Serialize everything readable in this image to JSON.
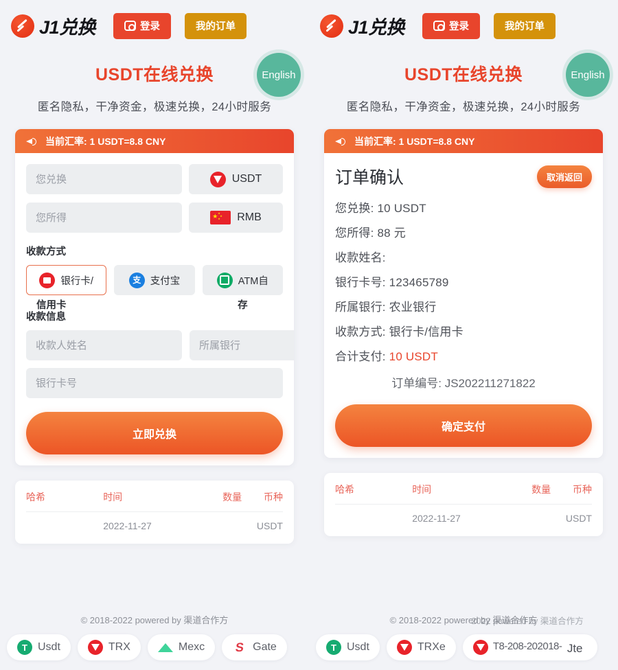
{
  "header": {
    "brand_name": "J1兑换",
    "login_label": "登录",
    "orders_label": "我的订单",
    "wallet_icon": "wallet-icon"
  },
  "hero": {
    "title": "USDT在线兑换",
    "subtitle": "匿名隐私，干净资金，极速兑换，24小时服务",
    "lang_badge": "English"
  },
  "rate_bar": {
    "text": "当前汇率: 1 USDT=8.8 CNY",
    "icon": "megaphone-icon"
  },
  "exchange_form": {
    "pay_placeholder": "您兑换",
    "receive_placeholder": "您所得",
    "pay_currency": "USDT",
    "receive_currency": "RMB",
    "pay_currency_icon": "tron-usdt-icon",
    "receive_currency_icon": "china-flag-icon",
    "method_label": "收款方式",
    "methods": [
      {
        "label": "银行卡/",
        "overflow": "信用卡",
        "icon": "bank-card-icon",
        "active": true
      },
      {
        "label": "支付宝",
        "overflow": "",
        "icon": "alipay-icon",
        "active": false
      },
      {
        "label": "ATM自",
        "overflow": "存",
        "icon": "atm-icon",
        "active": false
      }
    ],
    "info_label": "收款信息",
    "name_placeholder": "收款人姓名",
    "bank_placeholder": "所属银行",
    "card_placeholder": "银行卡号",
    "submit_label": "立即兑换"
  },
  "order_confirm": {
    "title": "订单确认",
    "cancel_label": "取消返回",
    "lines": [
      {
        "label": "您兑换:",
        "value": "10 USDT",
        "accent": false
      },
      {
        "label": "您所得:",
        "value": "88 元",
        "accent": false
      },
      {
        "label": "收款姓名:",
        "value": "",
        "accent": false
      },
      {
        "label": "银行卡号:",
        "value": "123465789",
        "accent": false
      },
      {
        "label": "所属银行:",
        "value": "农业银行",
        "accent": false
      },
      {
        "label": "收款方式:",
        "value": "银行卡/信用卡",
        "accent": false
      },
      {
        "label": "合计支付:",
        "value": "10 USDT",
        "accent": true
      }
    ],
    "order_no_label": "订单编号:",
    "order_no": "JS202211271822",
    "submit_label": "确定支付"
  },
  "tx_table": {
    "headers": [
      "哈希",
      "时间",
      "数量",
      "币种"
    ],
    "rows": [
      {
        "hash": "",
        "time": "2022-11-27",
        "amount": "",
        "coin": "USDT"
      }
    ]
  },
  "footer": {
    "copyright": "© 2018-2022 powered by 渠道合作方",
    "copyright_glitch_ghost": "2022 powered by 渠道合作方",
    "chips_left": [
      {
        "label": "Usdt",
        "icon": "usdt-icon"
      },
      {
        "label": "TRX",
        "icon": "trx-icon"
      },
      {
        "label": "Mexc",
        "icon": "mexc-icon"
      },
      {
        "label": "Gate",
        "icon": "gate-icon"
      }
    ],
    "chips_right": [
      {
        "label": "Usdt",
        "icon": "usdt-icon"
      },
      {
        "label": "TRXe",
        "icon": "trx-icon"
      }
    ],
    "glitch_chip": {
      "icon": "trx-icon",
      "text_a": "T8-208-202018-",
      "text_b": "Jte"
    }
  },
  "colors": {
    "accent_red": "#e8452c",
    "accent_orange": "#f07238",
    "orders_gold": "#d4920b",
    "lang_teal": "#58b79c",
    "table_header": "#e8655a",
    "page_bg": "#f2f3f7"
  }
}
